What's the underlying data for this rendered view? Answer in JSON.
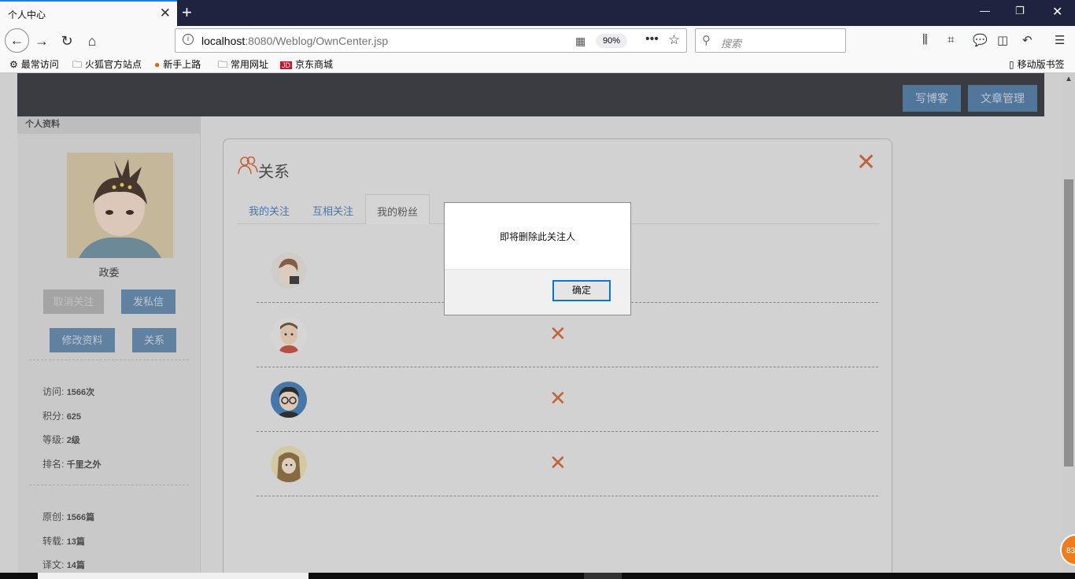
{
  "browser": {
    "tab_title": "个人中心",
    "url_host": "localhost",
    "url_path": ":8080/Weblog/OwnCenter.jsp",
    "zoom": "90%",
    "search_placeholder": "搜索",
    "bookmarks": [
      "最常访问",
      "火狐官方站点",
      "新手上路",
      "常用网址",
      "京东商城"
    ],
    "mobile_bookmarks": "移动版书签"
  },
  "header": {
    "write_blog": "写博客",
    "article_manage": "文章管理"
  },
  "sidebar": {
    "title": "个人资料",
    "name": "政委",
    "unfollow": "取消关注",
    "send_message": "发私信",
    "edit_profile": "修改资料",
    "relations": "关系",
    "visits_label": "访问:",
    "visits_value": "1566次",
    "points_label": "积分:",
    "points_value": "625",
    "level_label": "等级:",
    "level_value": "2级",
    "rank_label": "排名:",
    "rank_value": "千里之外",
    "original_label": "原创:",
    "original_value": "1566篇",
    "repost_label": "转载:",
    "repost_value": "13篇",
    "translate_label": "译文:",
    "translate_value": "14篇"
  },
  "panel": {
    "title": "关系",
    "tabs": [
      "我的关注",
      "互相关注",
      "我的粉丝"
    ],
    "active_tab": "我的粉丝"
  },
  "dialog": {
    "message": "即将删除此关注人",
    "ok": "确定"
  },
  "floating_badge": "83",
  "colors": {
    "accent": "#d5602c",
    "button": "#4a78a6",
    "header": "#2f3138"
  }
}
